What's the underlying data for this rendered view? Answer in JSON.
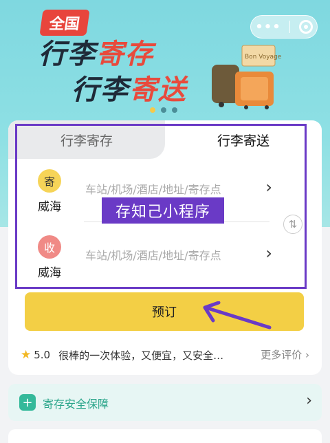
{
  "banner": {
    "badge": "全国",
    "line1_a": "行李",
    "line1_b": "寄存",
    "line2_a": "行李",
    "line2_b": "寄送",
    "luggage_tag": "Bon Voyage"
  },
  "capsule": {
    "more": "•••"
  },
  "tabs": {
    "left": "行李寄存",
    "right": "行李寄送",
    "active": "right"
  },
  "sender": {
    "badge": "寄",
    "city": "威海",
    "placeholder": "车站/机场/酒店/地址/寄存点"
  },
  "receiver": {
    "badge": "收",
    "city": "威海",
    "placeholder": "车站/机场/酒店/地址/寄存点"
  },
  "swap_icon": "⇅",
  "overlay_label": "存知己小程序",
  "book_button": "预订",
  "review": {
    "score": "5.0",
    "text": "很棒的一次体验，又便宜，又安全…",
    "more": "更多评价"
  },
  "safety": {
    "label": "寄存安全保障"
  },
  "colors": {
    "accent_yellow": "#f3cf45",
    "frame_purple": "#6a3ac6",
    "safety_green": "#34b99a"
  }
}
